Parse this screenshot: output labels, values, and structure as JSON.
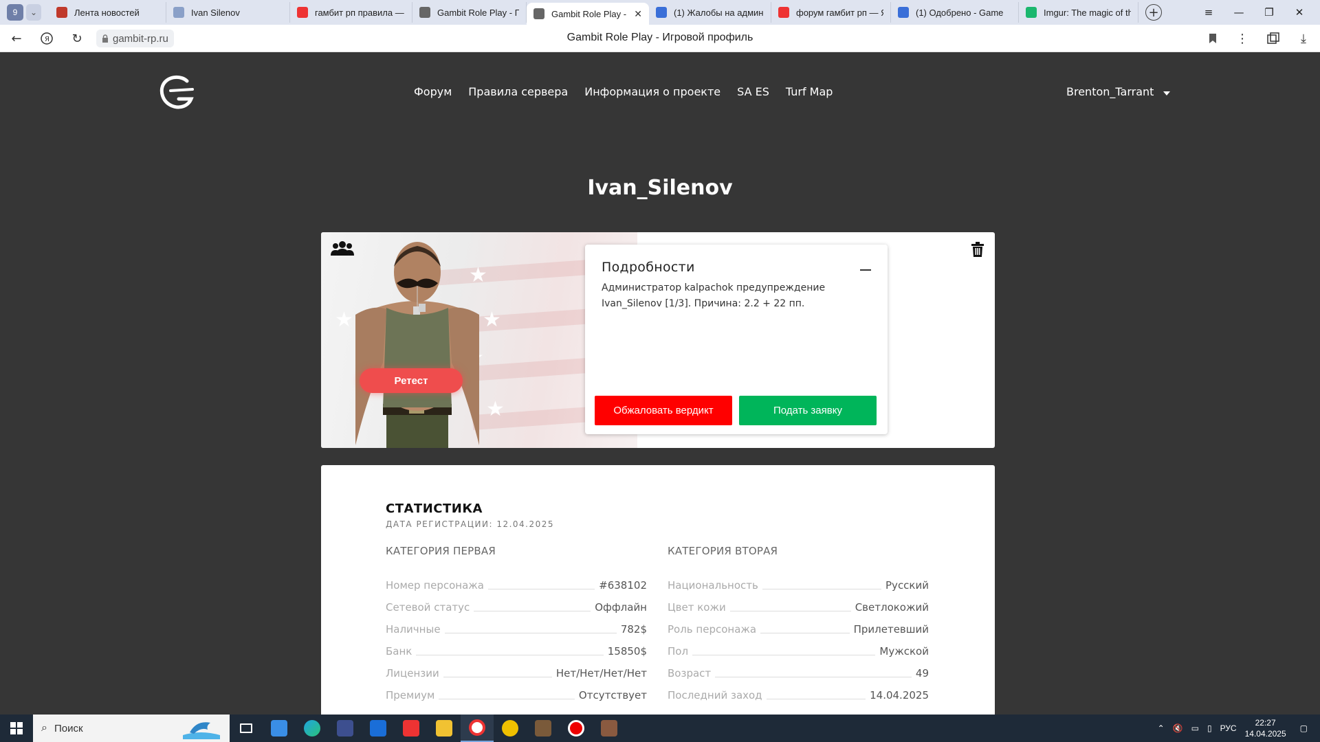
{
  "browser": {
    "tab_count": "9",
    "tabs": [
      {
        "title": "Лента новостей",
        "color": "#c0392b",
        "icon": "vk-news-icon"
      },
      {
        "title": "Ivan Silenov",
        "color": "#8aa0c8",
        "icon": "gambit-icon"
      },
      {
        "title": "гамбит рп правила —",
        "color": "#e33",
        "icon": "yandex-icon"
      },
      {
        "title": "Gambit Role Play - Пр",
        "color": "#666",
        "icon": "gambit-icon"
      },
      {
        "title": "Gambit Role Play - И",
        "color": "#666",
        "icon": "gambit-icon",
        "active": true
      },
      {
        "title": "(1) Жалобы на админ",
        "color": "#3a6fd8",
        "icon": "forum-icon"
      },
      {
        "title": "форум гамбит рп — Я",
        "color": "#e33",
        "icon": "yandex-icon"
      },
      {
        "title": "(1) Одобрено - Game",
        "color": "#3a6fd8",
        "icon": "forum-icon"
      },
      {
        "title": "Imgur: The magic of th",
        "color": "#1bb76e",
        "icon": "imgur-icon"
      }
    ],
    "url": "gambit-rp.ru",
    "page_title": "Gambit Role Play - Игровой профиль"
  },
  "site": {
    "nav": [
      "Форум",
      "Правила сервера",
      "Информация о проекте",
      "SA ES",
      "Turf Map"
    ],
    "user": "Brenton_Tarrant"
  },
  "profile": {
    "name": "Ivan_Silenov",
    "retest_label": "Ретест"
  },
  "details": {
    "title": "Подробности",
    "text": "Администратор kalpachok предупреждение Ivan_Silenov [1/3]. Причина: 2.2 + 22 пп.",
    "appeal_label": "Обжаловать вердикт",
    "apply_label": "Подать заявку",
    "appeal_color": "#ff0000",
    "apply_color": "#00b55a"
  },
  "stats": {
    "title": "СТАТИСТИКА",
    "registration": "ДАТА РЕГИСТРАЦИИ: 12.04.2025",
    "category_first": {
      "title": "КАТЕГОРИЯ ПЕРВАЯ",
      "rows": [
        {
          "label": "Номер персонажа",
          "value": "#638102"
        },
        {
          "label": "Сетевой статус",
          "value": "Оффлайн"
        },
        {
          "label": "Наличные",
          "value": "782$"
        },
        {
          "label": "Банк",
          "value": "15850$"
        },
        {
          "label": "Лицензии",
          "value": "Нет/Нет/Нет/Нет"
        },
        {
          "label": "Премиум",
          "value": "Отсутствует"
        }
      ]
    },
    "category_second": {
      "title": "КАТЕГОРИЯ ВТОРАЯ",
      "rows": [
        {
          "label": "Национальность",
          "value": "Русский"
        },
        {
          "label": "Цвет кожи",
          "value": "Светлокожий"
        },
        {
          "label": "Роль персонажа",
          "value": "Прилетевший"
        },
        {
          "label": "Пол",
          "value": "Мужской"
        },
        {
          "label": "Возраст",
          "value": "49"
        },
        {
          "label": "Последний заход",
          "value": "14.04.2025"
        }
      ]
    }
  },
  "taskbar": {
    "search_placeholder": "Поиск",
    "language": "РУС",
    "time": "22:27",
    "date": "14.04.2025"
  }
}
